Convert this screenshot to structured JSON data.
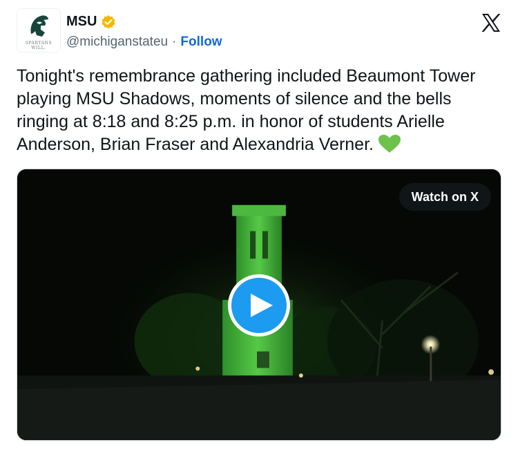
{
  "account": {
    "name": "MSU",
    "handle": "@michiganstateu",
    "separator": "·",
    "follow_label": "Follow",
    "avatar_tagline": "SPARTANS WILL.",
    "verified_color": "#f5b700"
  },
  "header": {
    "platform_icon": "x-logo-icon"
  },
  "post": {
    "text": "Tonight's remembrance gathering included Beaumont Tower playing MSU Shadows, moments of silence and the bells ringing at 8:18 and 8:25 p.m. in honor of students Arielle Anderson, Brian Fraser and Alexandria Verner.",
    "emoji": "green-heart-icon"
  },
  "media": {
    "watch_label": "Watch on X",
    "play_icon": "play-icon",
    "accent_color": "#1d9bf0"
  },
  "colors": {
    "brand_green": "#18453b",
    "link_blue": "#0f6ad8",
    "tower_green": "#3fae3a"
  }
}
